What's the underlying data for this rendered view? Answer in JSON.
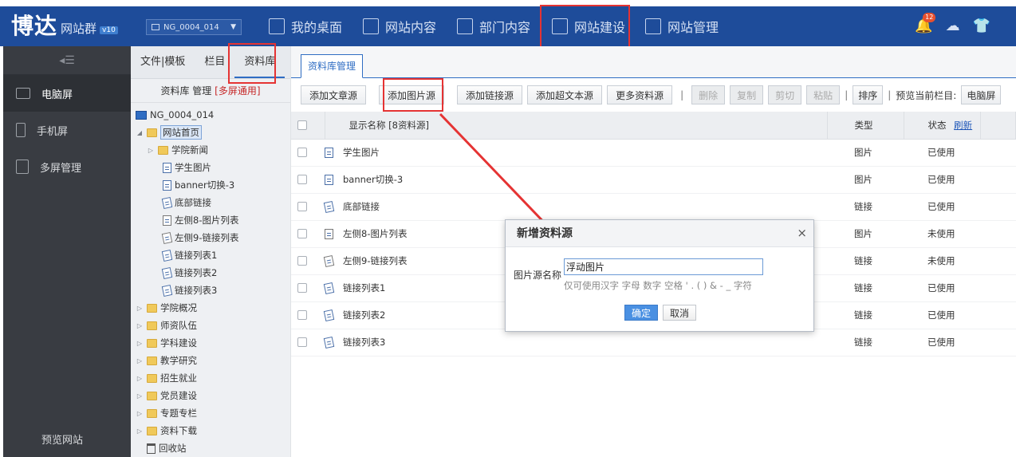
{
  "header": {
    "logo_main": "博达",
    "logo_sub": "网站群",
    "logo_version": "v10",
    "site_selector": "NG_0004_014",
    "nav": [
      {
        "label": "我的桌面",
        "icon": "grid-icon"
      },
      {
        "label": "网站内容",
        "icon": "edit-icon"
      },
      {
        "label": "部门内容",
        "icon": "org-chart-icon"
      },
      {
        "label": "网站建设",
        "icon": "page-add-icon"
      },
      {
        "label": "网站管理",
        "icon": "monitor-gear-icon"
      }
    ],
    "notification_count": "12",
    "highlight_color": "#e53333"
  },
  "sidebar": {
    "items": [
      {
        "label": "电脑屏",
        "icon": "desktop-icon"
      },
      {
        "label": "手机屏",
        "icon": "mobile-icon"
      },
      {
        "label": "多屏管理",
        "icon": "multi-screen-icon"
      }
    ],
    "preview_label": "预览网站"
  },
  "tree_panel": {
    "tabs": [
      "文件|模板",
      "栏目",
      "资料库"
    ],
    "manager_title": "资料库 管理",
    "manager_tag": "[多屏通用]",
    "root": "NG_0004_014",
    "nodes": [
      {
        "label": "网站首页",
        "type": "folder"
      },
      {
        "label": "学院新闻",
        "type": "folder"
      },
      {
        "label": "学生图片",
        "type": "doc"
      },
      {
        "label": "banner切换-3",
        "type": "doc"
      },
      {
        "label": "底部链接",
        "type": "link"
      },
      {
        "label": "左侧8-图片列表",
        "type": "doc"
      },
      {
        "label": "左侧9-链接列表",
        "type": "link"
      },
      {
        "label": "链接列表1",
        "type": "link"
      },
      {
        "label": "链接列表2",
        "type": "link"
      },
      {
        "label": "链接列表3",
        "type": "link"
      },
      {
        "label": "学院概况",
        "type": "folder"
      },
      {
        "label": "师资队伍",
        "type": "folder"
      },
      {
        "label": "学科建设",
        "type": "folder"
      },
      {
        "label": "教学研究",
        "type": "folder"
      },
      {
        "label": "招生就业",
        "type": "folder"
      },
      {
        "label": "党员建设",
        "type": "folder"
      },
      {
        "label": "专题专栏",
        "type": "folder"
      },
      {
        "label": "资料下载",
        "type": "folder"
      },
      {
        "label": "回收站",
        "type": "trash"
      }
    ]
  },
  "main": {
    "tab": "资料库管理",
    "toolbar": {
      "buttons": [
        "添加文章源",
        "添加图片源",
        "添加链接源",
        "添加超文本源",
        "更多资料源"
      ],
      "disabled": [
        "删除",
        "复制",
        "剪切",
        "粘贴"
      ],
      "sort": "排序",
      "preview_label": "预览当前栏目:",
      "preview_button": "电脑屏"
    },
    "table": {
      "headers": {
        "name": "显示名称 [8资料源]",
        "type": "类型",
        "status": "状态",
        "refresh": "刷新"
      },
      "rows": [
        {
          "name": "学生图片",
          "type": "图片",
          "status": "已使用"
        },
        {
          "name": "banner切换-3",
          "type": "图片",
          "status": "已使用"
        },
        {
          "name": "底部链接",
          "type": "链接",
          "status": "已使用"
        },
        {
          "name": "左侧8-图片列表",
          "type": "图片",
          "status": "未使用"
        },
        {
          "name": "左侧9-链接列表",
          "type": "链接",
          "status": "未使用"
        },
        {
          "name": "链接列表1",
          "type": "链接",
          "status": "已使用"
        },
        {
          "name": "链接列表2",
          "type": "链接",
          "status": "已使用"
        },
        {
          "name": "链接列表3",
          "type": "链接",
          "status": "已使用"
        }
      ]
    }
  },
  "dialog": {
    "title": "新增资料源",
    "close": "×",
    "field_label": "图片源名称",
    "field_value": "浮动图片",
    "hint": "仅可使用汉字 字母 数字 空格 ' . ( ) & - _ 字符",
    "ok": "确定",
    "cancel": "取消"
  }
}
